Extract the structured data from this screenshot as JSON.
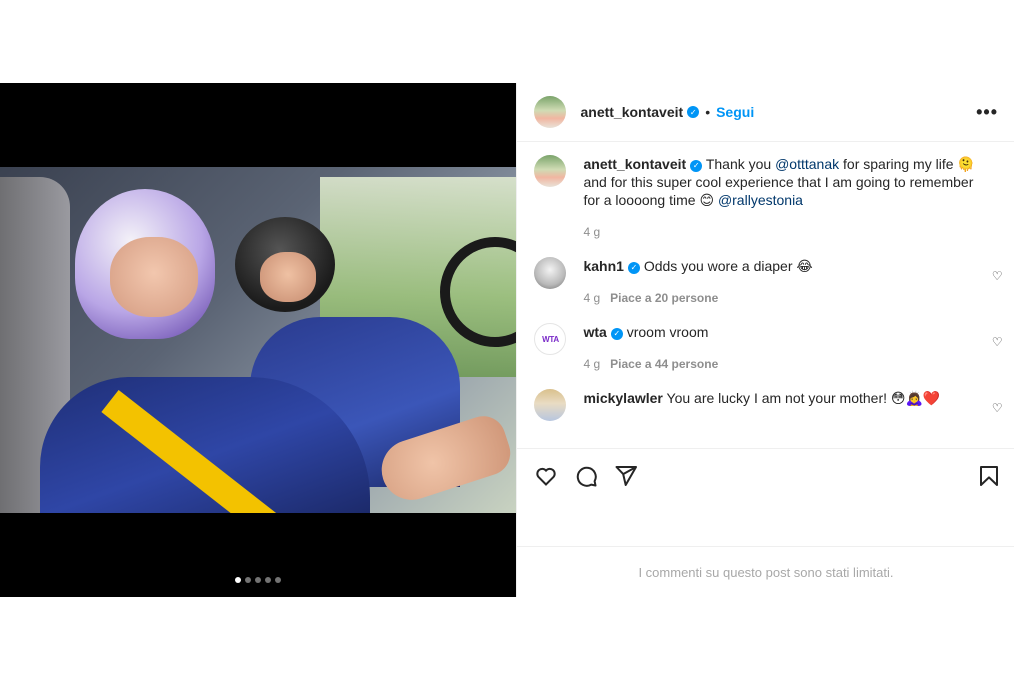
{
  "header": {
    "username": "anett_kontaveit",
    "separator": "•",
    "follow_label": "Segui",
    "more_label": "•••"
  },
  "media": {
    "carousel_count": 5,
    "active_index": 0
  },
  "caption": {
    "username": "anett_kontaveit",
    "text_before": "Thank you ",
    "mention_1": "@otttanak",
    "text_middle": " for sparing my life 🫠 and for this super cool experience that I am going to remember for a loooong time 😊 ",
    "mention_2": "@rallyestonia",
    "time": "4 g"
  },
  "comments": [
    {
      "username": "kahn1",
      "verified": true,
      "text": "Odds you wore a diaper 😂",
      "time": "4 g",
      "likes": "Piace a 20 persone"
    },
    {
      "username": "wta",
      "verified": true,
      "text": "vroom vroom",
      "time": "4 g",
      "likes": "Piace a 44 persone",
      "avatar_text": "WTA"
    },
    {
      "username": "mickylawler",
      "verified": false,
      "text": "You are lucky I am not your mother! 😳🙇‍♀️❤️"
    }
  ],
  "actions": {
    "like_icon": "heart-icon",
    "comment_icon": "comment-icon",
    "share_icon": "share-icon",
    "save_icon": "bookmark-icon"
  },
  "footer": {
    "limited_text": "I commenti su questo post sono stati limitati."
  },
  "colors": {
    "accent": "#0095f6",
    "text": "#262626",
    "muted": "#8e8e8e"
  }
}
